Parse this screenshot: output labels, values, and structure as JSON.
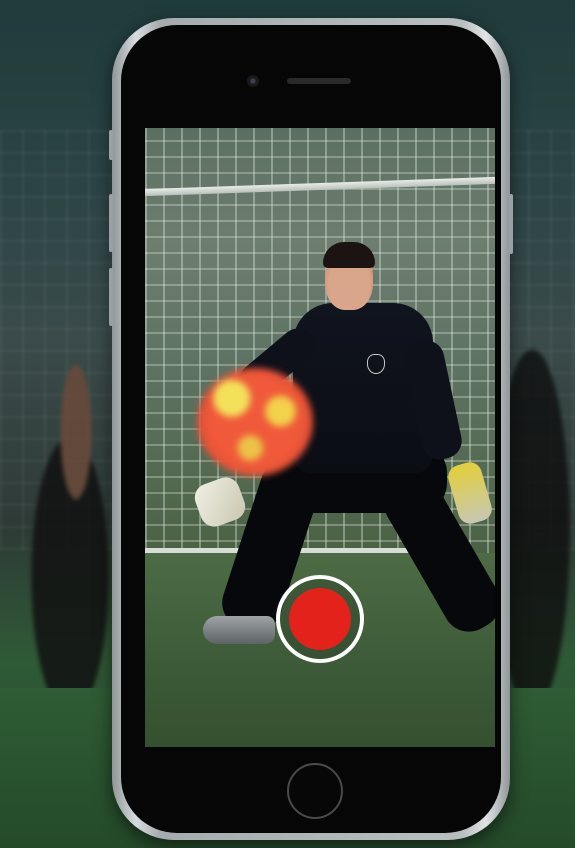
{
  "scene": {
    "description_icons": {
      "phone": "smartphone-frame",
      "record": "record-button"
    }
  },
  "camera_ui": {
    "record_button_color": "#e4221c",
    "record_ring_color": "#ffffff"
  }
}
